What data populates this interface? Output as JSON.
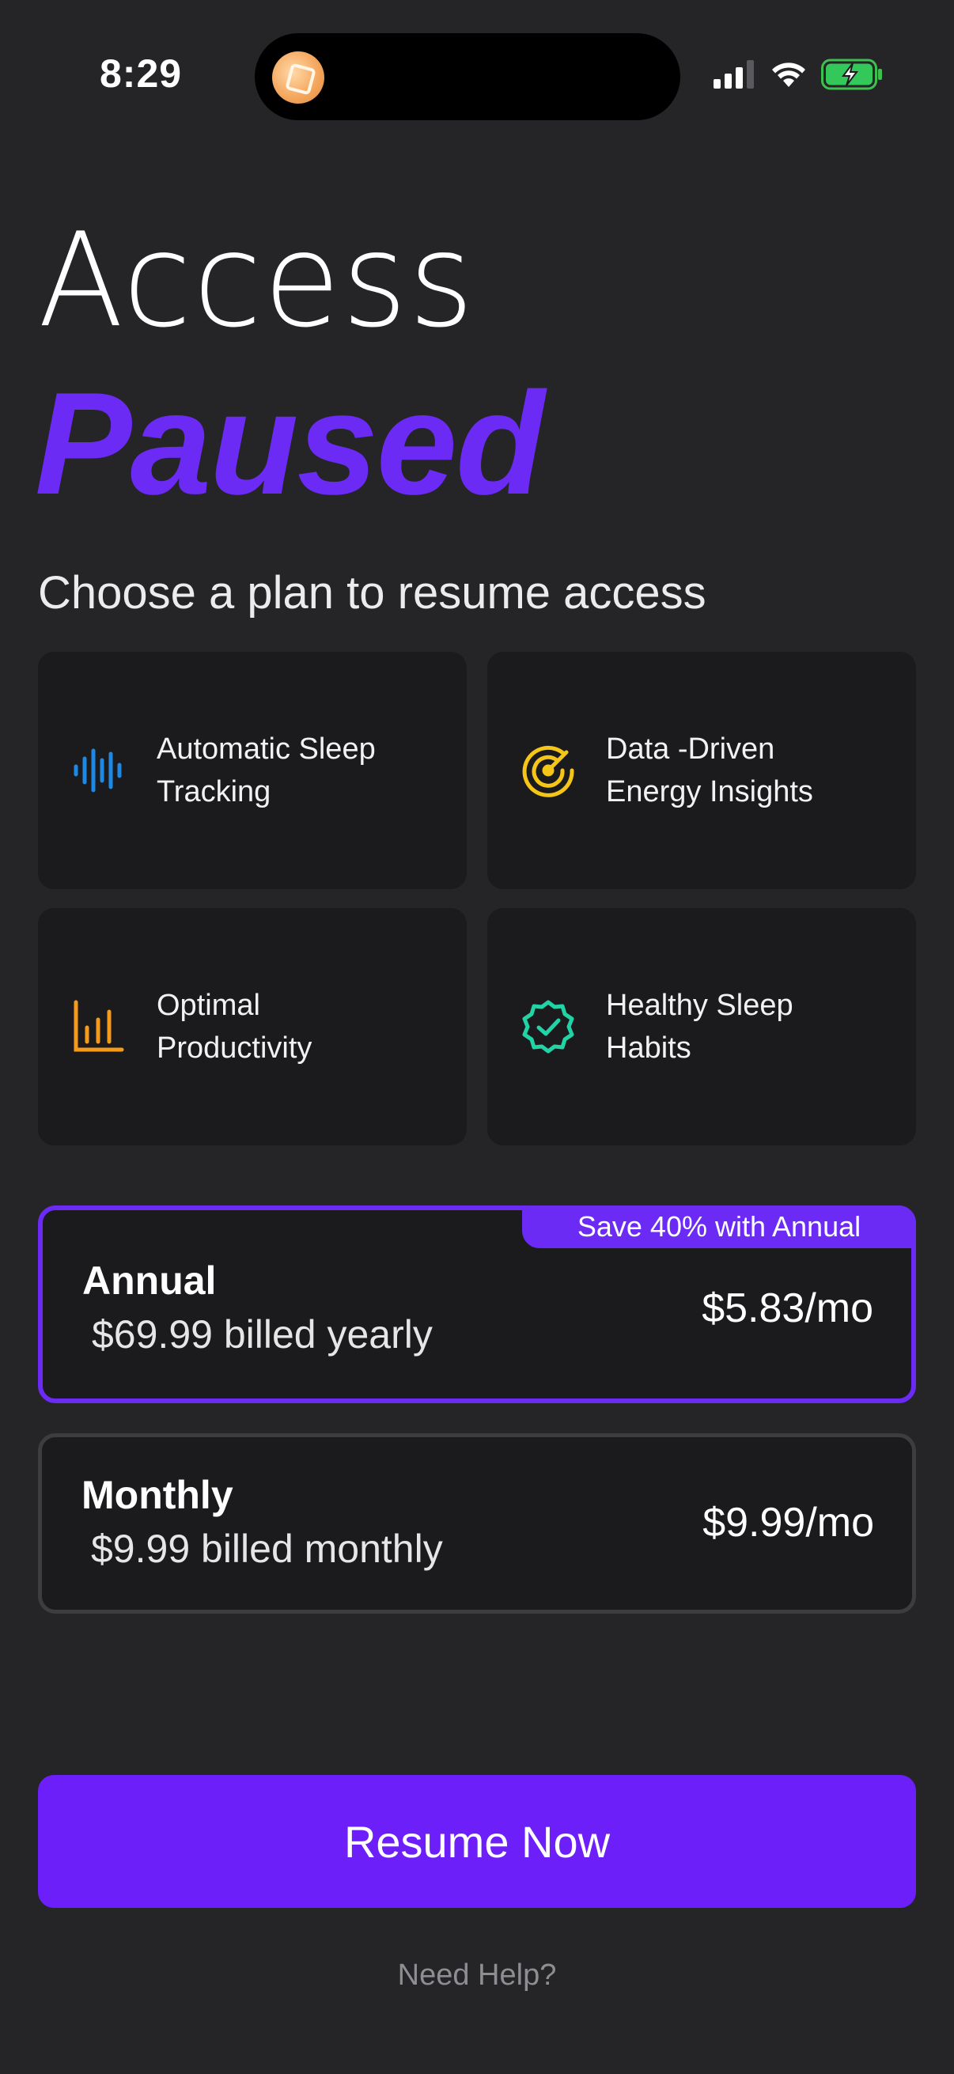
{
  "status_bar": {
    "time": "8:29",
    "icons": [
      "cellular-signal-icon",
      "wifi-icon",
      "battery-charging-icon"
    ]
  },
  "header": {
    "title_line1": "Access",
    "title_line2": "Paused",
    "subtitle": "Choose a plan to resume access"
  },
  "features": [
    {
      "label": "Automatic Sleep Tracking",
      "icon": "sound-wave-icon",
      "color": "#1e88e5"
    },
    {
      "label": "Data -Driven Energy Insights",
      "icon": "radar-icon",
      "color": "#f5c518"
    },
    {
      "label": "Optimal Productivity",
      "icon": "bar-chart-icon",
      "color": "#f59a1b"
    },
    {
      "label": "Healthy Sleep Habits",
      "icon": "verified-badge-icon",
      "color": "#22d3a6"
    }
  ],
  "plans": {
    "annual": {
      "name": "Annual",
      "billing": "$69.99 billed yearly",
      "price": "$5.83/mo",
      "badge": "Save 40% with Annual",
      "selected": true
    },
    "monthly": {
      "name": "Monthly",
      "billing": "$9.99 billed monthly",
      "price": "$9.99/mo",
      "selected": false
    }
  },
  "actions": {
    "resume_label": "Resume Now",
    "help_label": "Need Help?"
  },
  "colors": {
    "accent": "#6c2bf5",
    "background": "#252528",
    "card": "#1b1b1d"
  }
}
